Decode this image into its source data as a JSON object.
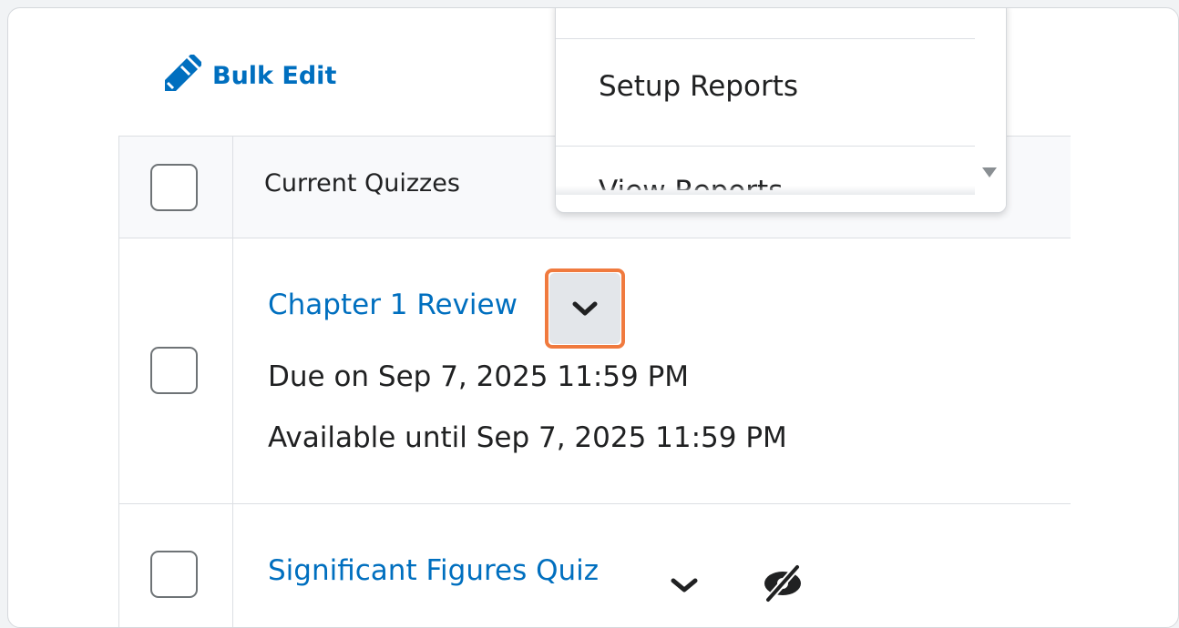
{
  "toolbar": {
    "bulk_edit_label": "Bulk Edit"
  },
  "table": {
    "column_header": "Current Quizzes",
    "rows": [
      {
        "title": "Chapter 1 Review",
        "due": "Due on Sep 7, 2025 11:59 PM",
        "available": "Available until Sep 7, 2025 11:59 PM"
      },
      {
        "title": "Significant Figures Quiz"
      }
    ]
  },
  "dropdown": {
    "items": [
      "Setup Reports",
      "View Reports"
    ]
  },
  "colors": {
    "link": "#006fbf",
    "highlight": "#f07a3e",
    "text": "#202122"
  },
  "icons": [
    "pencil-icon",
    "chevron-down-icon",
    "eye-slash-icon",
    "scroll-down-arrow-icon"
  ]
}
